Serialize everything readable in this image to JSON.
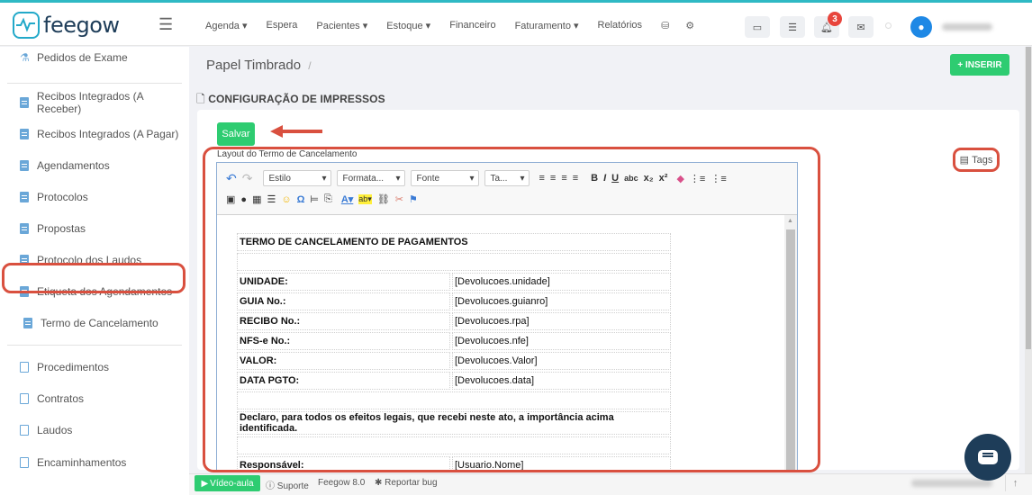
{
  "app": {
    "name": "feegow"
  },
  "nav": {
    "items": [
      "Agenda ▾",
      "Espera",
      "Pacientes ▾",
      "Estoque ▾",
      "Financeiro",
      "Faturamento ▾",
      "Relatórios"
    ],
    "notification_count": "3"
  },
  "sidebar": {
    "items": [
      {
        "label": "Pedidos de Exame",
        "icon": "flask-icon"
      },
      {
        "label": "Recibos Integrados (A Receber)",
        "icon": "doc-icon"
      },
      {
        "label": "Recibos Integrados (A Pagar)",
        "icon": "doc-icon"
      },
      {
        "label": "Agendamentos",
        "icon": "doc-icon"
      },
      {
        "label": "Protocolos",
        "icon": "doc-icon"
      },
      {
        "label": "Propostas",
        "icon": "doc-icon"
      },
      {
        "label": "Protocolo dos Laudos",
        "icon": "doc-icon"
      },
      {
        "label": "Etiqueta dos Agendamentos",
        "icon": "doc-icon"
      },
      {
        "label": "Termo de Cancelamento",
        "icon": "doc-icon",
        "active": true
      },
      {
        "label": "Procedimentos",
        "icon": "copy-icon"
      },
      {
        "label": "Contratos",
        "icon": "copy-icon"
      },
      {
        "label": "Laudos",
        "icon": "copy-icon"
      },
      {
        "label": "Encaminhamentos",
        "icon": "copy-icon"
      }
    ]
  },
  "header": {
    "breadcrumb": "Papel Timbrado",
    "breadcrumb_sep": "/",
    "insert_label": "+ INSERIR",
    "section_title": "CONFIGURAÇÃO DE IMPRESSOS"
  },
  "editor": {
    "save_label": "Salvar",
    "label": "Layout do Termo de Cancelamento",
    "tags_label": "Tags",
    "combos": {
      "style": "Estilo",
      "format": "Formata...",
      "font": "Fonte",
      "size": "Ta..."
    },
    "document": {
      "title": "TERMO DE CANCELAMENTO DE PAGAMENTOS",
      "rows": [
        {
          "label": "UNIDADE:",
          "value": "[Devolucoes.unidade]"
        },
        {
          "label": "GUIA No.:",
          "value": "[Devolucoes.guianro]"
        },
        {
          "label": "RECIBO No.:",
          "value": "[Devolucoes.rpa]"
        },
        {
          "label": "NFS-e No.:",
          "value": "[Devolucoes.nfe]"
        },
        {
          "label": "VALOR:",
          "value": "[Devolucoes.Valor]"
        },
        {
          "label": "DATA PGTO:",
          "value": "[Devolucoes.data]"
        }
      ],
      "declaration": "Declaro, para todos os efeitos legais, que recebi neste ato, a importância acima identificada.",
      "responsible_label": "Responsável:",
      "responsible_value": "[Usuario.Nome]"
    }
  },
  "footer": {
    "video": "Vídeo-aula",
    "support": "Suporte",
    "version": "Feegow 8.0",
    "report": "Reportar bug"
  },
  "colors": {
    "accent_green": "#2ecc71",
    "highlight_red": "#d9503f",
    "brand_navy": "#1e3d59",
    "brand_teal": "#23a9c9"
  }
}
